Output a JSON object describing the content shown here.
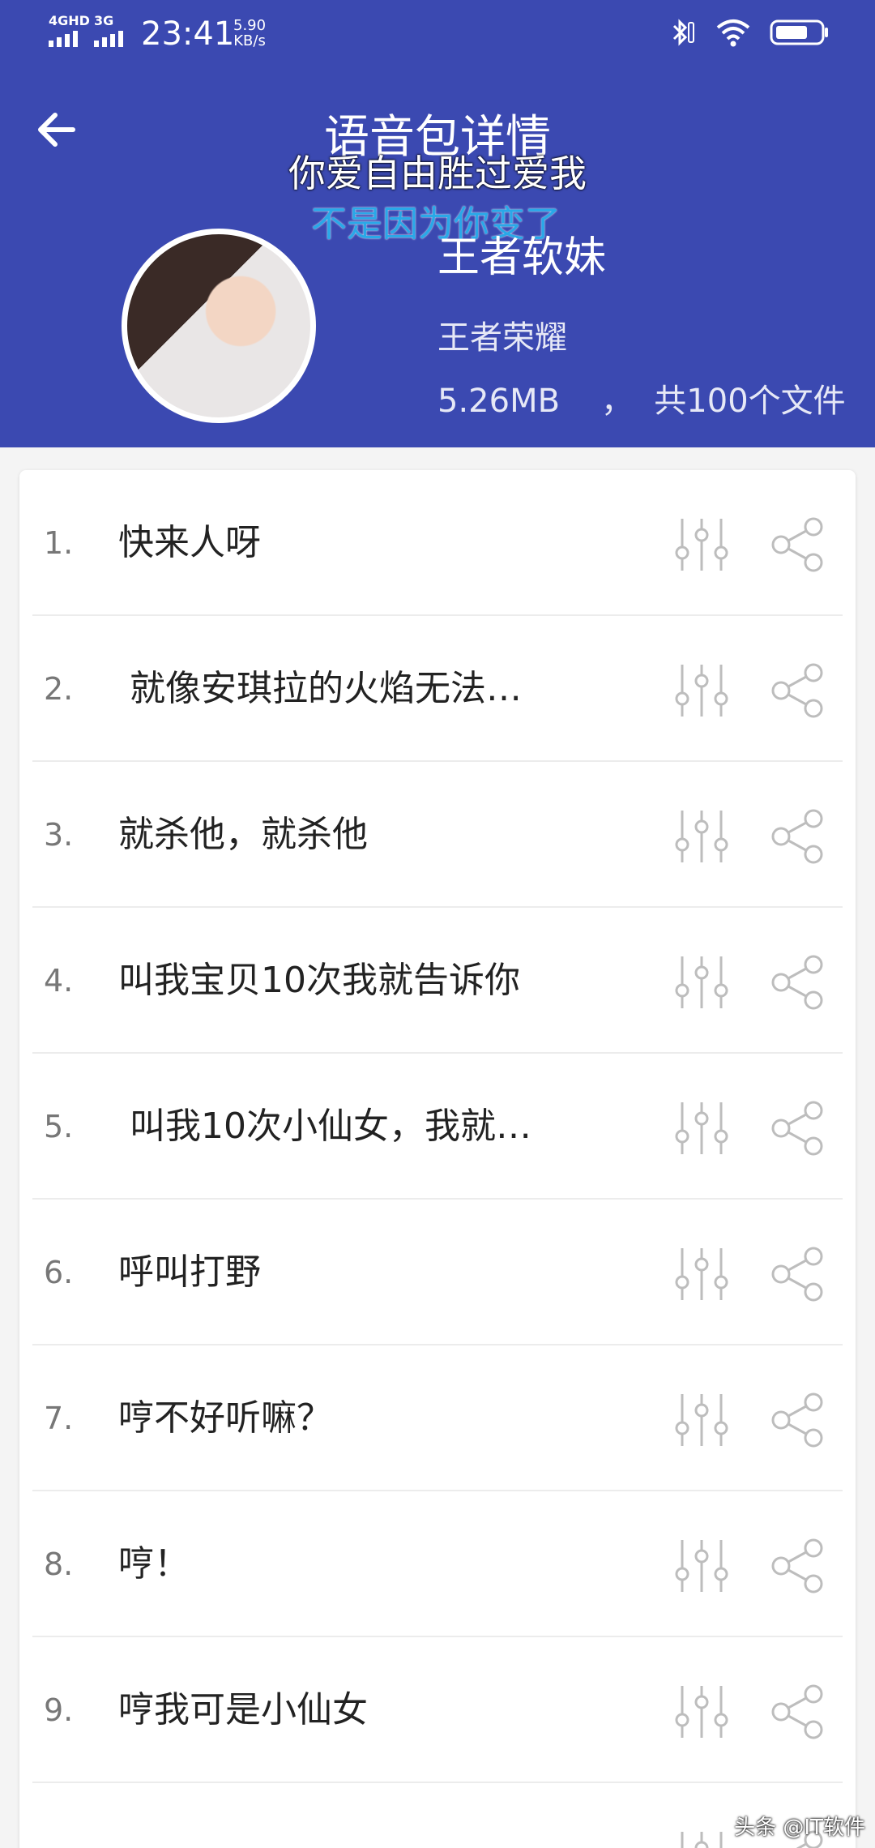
{
  "status_bar": {
    "network1": "4GHD",
    "network2": "3G",
    "time": "23:41",
    "speed_value": "5.90",
    "speed_unit": "KB/s"
  },
  "header": {
    "title": "语音包详情",
    "overlay_line1": "你爱自由胜过爱我",
    "overlay_line2": "不是因为你变了",
    "pack_name": "王者软妹",
    "game": "王者荣耀",
    "meta": "5.26MB    ，  共100个文件"
  },
  "items": [
    {
      "num": "1.",
      "title": "快来人呀"
    },
    {
      "num": "2.",
      "title": " 就像安琪拉的火焰无法…"
    },
    {
      "num": "3.",
      "title": "就杀他，就杀他"
    },
    {
      "num": "4.",
      "title": "叫我宝贝10次我就告诉你"
    },
    {
      "num": "5.",
      "title": " 叫我10次小仙女，我就…"
    },
    {
      "num": "6.",
      "title": "呼叫打野"
    },
    {
      "num": "7.",
      "title": "哼不好听嘛？"
    },
    {
      "num": "8.",
      "title": "哼！"
    },
    {
      "num": "9.",
      "title": "哼我可是小仙女"
    }
  ],
  "icons": {
    "back": "arrow-left-icon",
    "equalizer": "equalizer-icon",
    "share": "share-icon"
  },
  "colors": {
    "header_bg": "#3b49b1",
    "overlay_blue": "#29a8e8",
    "icon_gray": "#bdbdbd"
  },
  "watermark": "头条 @IT软件"
}
